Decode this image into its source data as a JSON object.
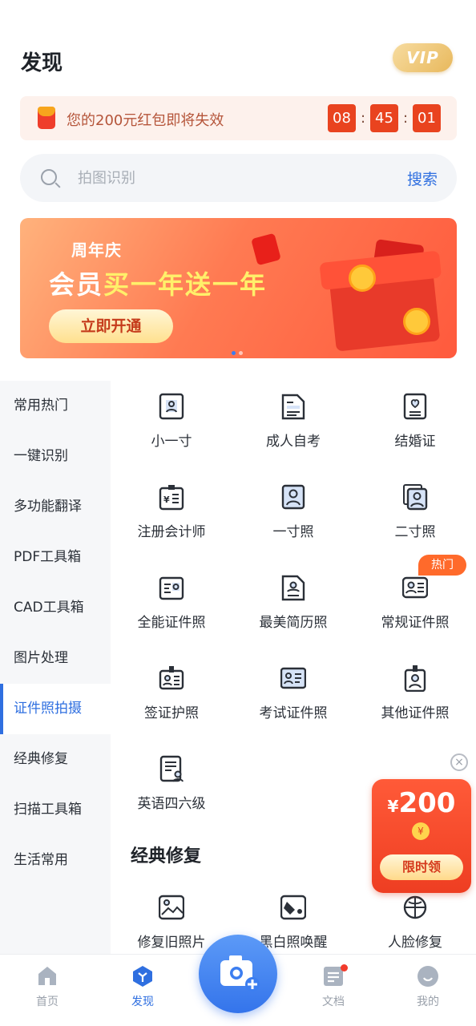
{
  "header": {
    "title": "发现",
    "vip_label": "VIP"
  },
  "promo": {
    "text": "您的200元红包即将失效",
    "timer": {
      "hours": "08",
      "minutes": "45",
      "seconds": "01",
      "separator": ":"
    }
  },
  "search": {
    "placeholder": "拍图识别",
    "button": "搜索"
  },
  "banner": {
    "subtitle": "周年庆",
    "title_part1": "会员",
    "title_highlight": "买一年送一年",
    "cta": "立即开通",
    "slide_count": 2,
    "active_slide": 1
  },
  "sidebar": {
    "items": [
      {
        "label": "常用热门"
      },
      {
        "label": "一键识别"
      },
      {
        "label": "多功能翻译"
      },
      {
        "label": "PDF工具箱"
      },
      {
        "label": "CAD工具箱"
      },
      {
        "label": "图片处理"
      },
      {
        "label": "证件照拍摄"
      },
      {
        "label": "经典修复"
      },
      {
        "label": "扫描工具箱"
      },
      {
        "label": "生活常用"
      }
    ],
    "active_index": 6
  },
  "grid": {
    "items": [
      {
        "label": "小一寸",
        "icon": "id-photo-icon"
      },
      {
        "label": "成人自考",
        "icon": "exam-document-icon"
      },
      {
        "label": "结婚证",
        "icon": "marriage-certificate-icon"
      },
      {
        "label": "注册会计师",
        "icon": "accountant-badge-icon"
      },
      {
        "label": "一寸照",
        "icon": "portrait-icon"
      },
      {
        "label": "二寸照",
        "icon": "double-portrait-icon"
      },
      {
        "label": "全能证件照",
        "icon": "all-purpose-id-icon"
      },
      {
        "label": "最美简历照",
        "icon": "resume-icon"
      },
      {
        "label": "常规证件照",
        "icon": "id-card-icon",
        "badge": "热门"
      },
      {
        "label": "签证护照",
        "icon": "visa-badge-icon"
      },
      {
        "label": "考试证件照",
        "icon": "exam-id-icon"
      },
      {
        "label": "其他证件照",
        "icon": "other-badge-icon"
      },
      {
        "label": "英语四六级",
        "icon": "english-exam-icon"
      }
    ]
  },
  "section": {
    "title": "经典修复",
    "items": [
      {
        "label": "修复旧照片",
        "icon": "old-photo-icon"
      },
      {
        "label": "黑白照唤醒",
        "icon": "colorize-icon"
      },
      {
        "label": "人脸修复",
        "icon": "face-repair-icon"
      }
    ]
  },
  "float_packet": {
    "currency": "¥",
    "amount": "200",
    "seal": "¥",
    "cta": "限时领",
    "close": "×"
  },
  "bottom_nav": {
    "items": [
      {
        "label": "首页"
      },
      {
        "label": "发现"
      },
      {
        "label": "文档"
      },
      {
        "label": "我的"
      }
    ],
    "active_index": 1
  },
  "colors": {
    "accent": "#2f6fe0",
    "timer": "#e9431f",
    "hot": "#ff6a2b"
  }
}
